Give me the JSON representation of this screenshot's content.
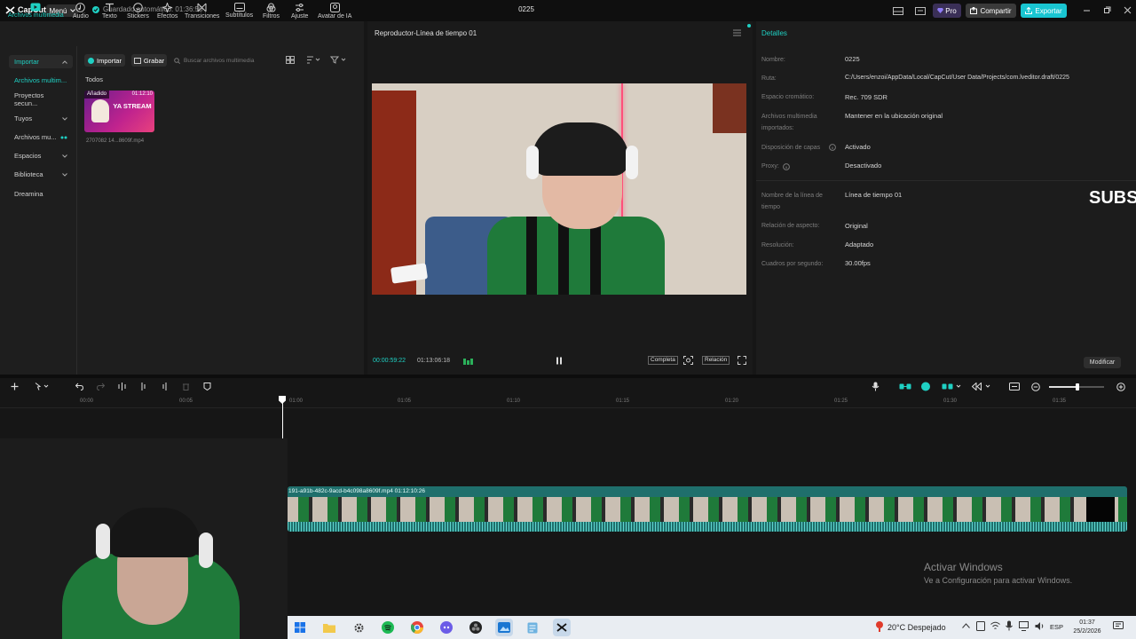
{
  "titlebar": {
    "logo": "CapCut",
    "menu": "Menú",
    "autosave": "Guardado automático: 01:36:50",
    "project_name": "0225",
    "pro": "Pro",
    "share": "Compartir",
    "export": "Exportar"
  },
  "toolbar": {
    "tools": [
      "Archivos multimedia",
      "Audio",
      "Texto",
      "Stickers",
      "Efectos",
      "Transiciones",
      "Subtítulos",
      "Filtros",
      "Ajuste",
      "Avatar de IA"
    ]
  },
  "media": {
    "categories": [
      "Importar",
      "Archivos multim...",
      "Proyectos secun...",
      "Tuyos",
      "Archivos mu...",
      "Espacios",
      "Biblioteca",
      "Dreamina"
    ],
    "import_btn": "Importar",
    "record_btn": "Grabar",
    "search_placeholder": "Buscar archivos multimedia",
    "filter_all": "Todos",
    "clip_badge": "Añadido",
    "clip_duration": "01:12:10",
    "clip_name": "2707082 14...8609f.mp4",
    "thumb_text": "YA STREAM"
  },
  "player": {
    "title": "Reproductor-Línea de tiempo 01",
    "current_time": "00:00:59:22",
    "total_time": "01:13:06:18",
    "full_label": "Completa",
    "ratio_label": "Relación"
  },
  "details": {
    "header": "Detalles",
    "rows": [
      {
        "label": "Nombre:",
        "value": "0225"
      },
      {
        "label": "Ruta:",
        "value": "C:/Users/enzoi/AppData/Local/CapCut/User Data/Projects/com.lveditor.draft/0225"
      },
      {
        "label": "Espacio cromático:",
        "value": "Rec. 709 SDR"
      },
      {
        "label": "Archivos multimedia importados:",
        "value": "Mantener en la ubicación original"
      },
      {
        "label": "Disposición de capas",
        "value": "Activado"
      },
      {
        "label": "Proxy:",
        "value": "Desactivado"
      },
      {
        "label": "Nombre de la línea de tiempo",
        "value": "Línea de tiempo 01"
      },
      {
        "label": "Relación de aspecto:",
        "value": "Original"
      },
      {
        "label": "Resolución:",
        "value": "Adaptado"
      },
      {
        "label": "Cuadros por segundo:",
        "value": "30.00fps"
      }
    ],
    "modify_btn": "Modificar",
    "overlay_text": "SUBS"
  },
  "timeline": {
    "ruler": [
      "00:00",
      "00:05",
      "01:00",
      "01:05",
      "01:10",
      "01:15",
      "01:20",
      "01:25",
      "01:30",
      "01:35"
    ],
    "clip_label": "191-a91b-482c-9acd-b4c098a8609f.mp4  01:12:10:26"
  },
  "windows": {
    "activate_title": "Activar Windows",
    "activate_sub": "Ve a Configuración para activar Windows.",
    "weather": "20°C Despejado",
    "lang": "ESP",
    "time": "01:37",
    "date": "25/2/2026"
  },
  "colors": {
    "accent": "#1fd0c3",
    "export_bg": "#19c5d1",
    "clip_bg": "#1f6f6c",
    "jersey_green": "#1f7a3a"
  }
}
